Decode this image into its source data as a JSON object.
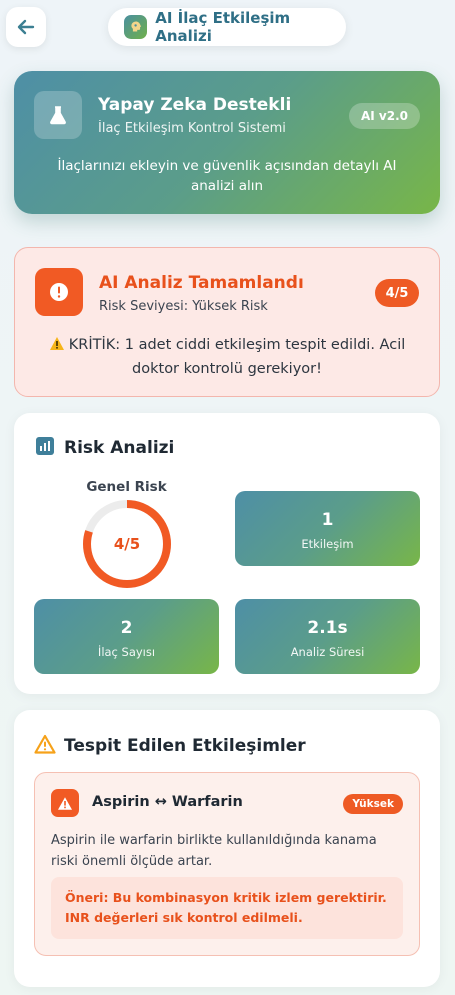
{
  "header": {
    "back_icon": "arrow-left-icon",
    "title": "AI İlaç Etkileşim Analizi",
    "title_icon": "brain-icon"
  },
  "hero": {
    "icon": "flask-icon",
    "title": "Yapay Zeka Destekli",
    "subtitle": "İlaç Etkileşim Kontrol Sistemi",
    "version": "AI v2.0",
    "description": "İlaçlarınızı ekleyin ve güvenlik açısından detaylı AI analizi alın"
  },
  "alert": {
    "icon": "exclamation-circle-icon",
    "title": "AI Analiz Tamamlandı",
    "risk_level": "Risk Seviyesi: Yüksek Risk",
    "score": "4/5",
    "message": "KRİTİK: 1 adet ciddi etkileşim tespit edildi. Acil doktor kontrolü gerekiyor!"
  },
  "risk_analysis": {
    "title": "Risk Analizi",
    "icon": "bar-chart-icon",
    "gauge_title": "Genel Risk",
    "gauge_value": "4/5",
    "gauge_fraction": 0.8,
    "stats": [
      {
        "value": "1",
        "label": "Etkileşim"
      },
      {
        "value": "2",
        "label": "İlaç Sayısı"
      },
      {
        "value": "2.1s",
        "label": "Analiz Süresi"
      }
    ]
  },
  "interactions": {
    "title": "Tespit Edilen Etkileşimler",
    "icon": "warning-triangle-icon",
    "items": [
      {
        "pair": "Aspirin ↔ Warfarin",
        "severity": "Yüksek",
        "description": "Aspirin ile warfarin birlikte kullanıldığında kanama riski önemli ölçüde artar.",
        "recommendation": "Öneri: Bu kombinasyon kritik izlem gerektirir. INR değerleri sık kontrol edilmeli."
      }
    ]
  },
  "colors": {
    "accent_orange": "#f15a24",
    "brand_teal": "#4e8fa6",
    "brand_green": "#78b648"
  }
}
